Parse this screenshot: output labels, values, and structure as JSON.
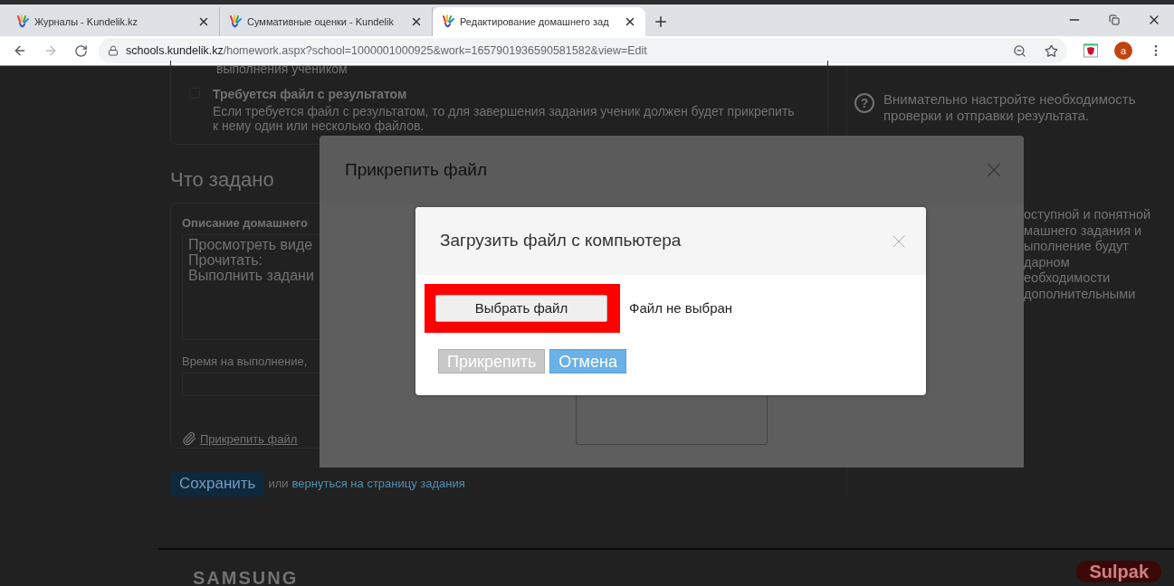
{
  "browser": {
    "tabs": [
      {
        "title": "Журналы - Kundelik.kz",
        "selected": false
      },
      {
        "title": "Суммативные оценки - Kundelik",
        "selected": false
      },
      {
        "title": "Редактирование домашнего зад",
        "selected": true
      }
    ],
    "url": {
      "host": "schools.kundelik.kz",
      "path": "/homework.aspx?school=1000001000925&work=1657901936590581582&view=Edit"
    },
    "avatar_letter": "a"
  },
  "page": {
    "cut_text": "выполнения учеником",
    "option": {
      "title": "Требуется файл с результатом",
      "description": "Если требуется файл с результатом, то для завершения задания ученик должен будет прикрепить к нему один или несколько файлов.",
      "checked": false
    },
    "section_title": "Что задано",
    "description_label": "Описание домашнего",
    "description_lines": [
      "Просмотреть виде",
      "Прочитать:",
      "Выполнить задани"
    ],
    "time_label": "Время на выполнение,",
    "attach_link": "Прикрепить файл",
    "save_button": "Сохранить",
    "or_text": "или",
    "back_link": "вернуться на страницу задания",
    "help_icon": "?",
    "hint": "Внимательно настройте необходимость проверки и отправки результата.",
    "hint_lines": [
      "оступной и понятной",
      "машнего задания и",
      "ыполнение будут",
      "дарном",
      "еобходимости",
      "дополнительными"
    ],
    "footer_logos": [
      "SAMSUNG",
      "Sulpak"
    ]
  },
  "attach_dialog": {
    "title": "Прикрепить файл"
  },
  "upload_dialog": {
    "title": "Загрузить файл с компьютера",
    "choose_button": "Выбрать файл",
    "file_status": "Файл не выбран",
    "highlighted": true,
    "buttons": [
      {
        "label": "Прикрепить",
        "disabled": true
      },
      {
        "label": "Отмена",
        "disabled": false
      }
    ]
  }
}
